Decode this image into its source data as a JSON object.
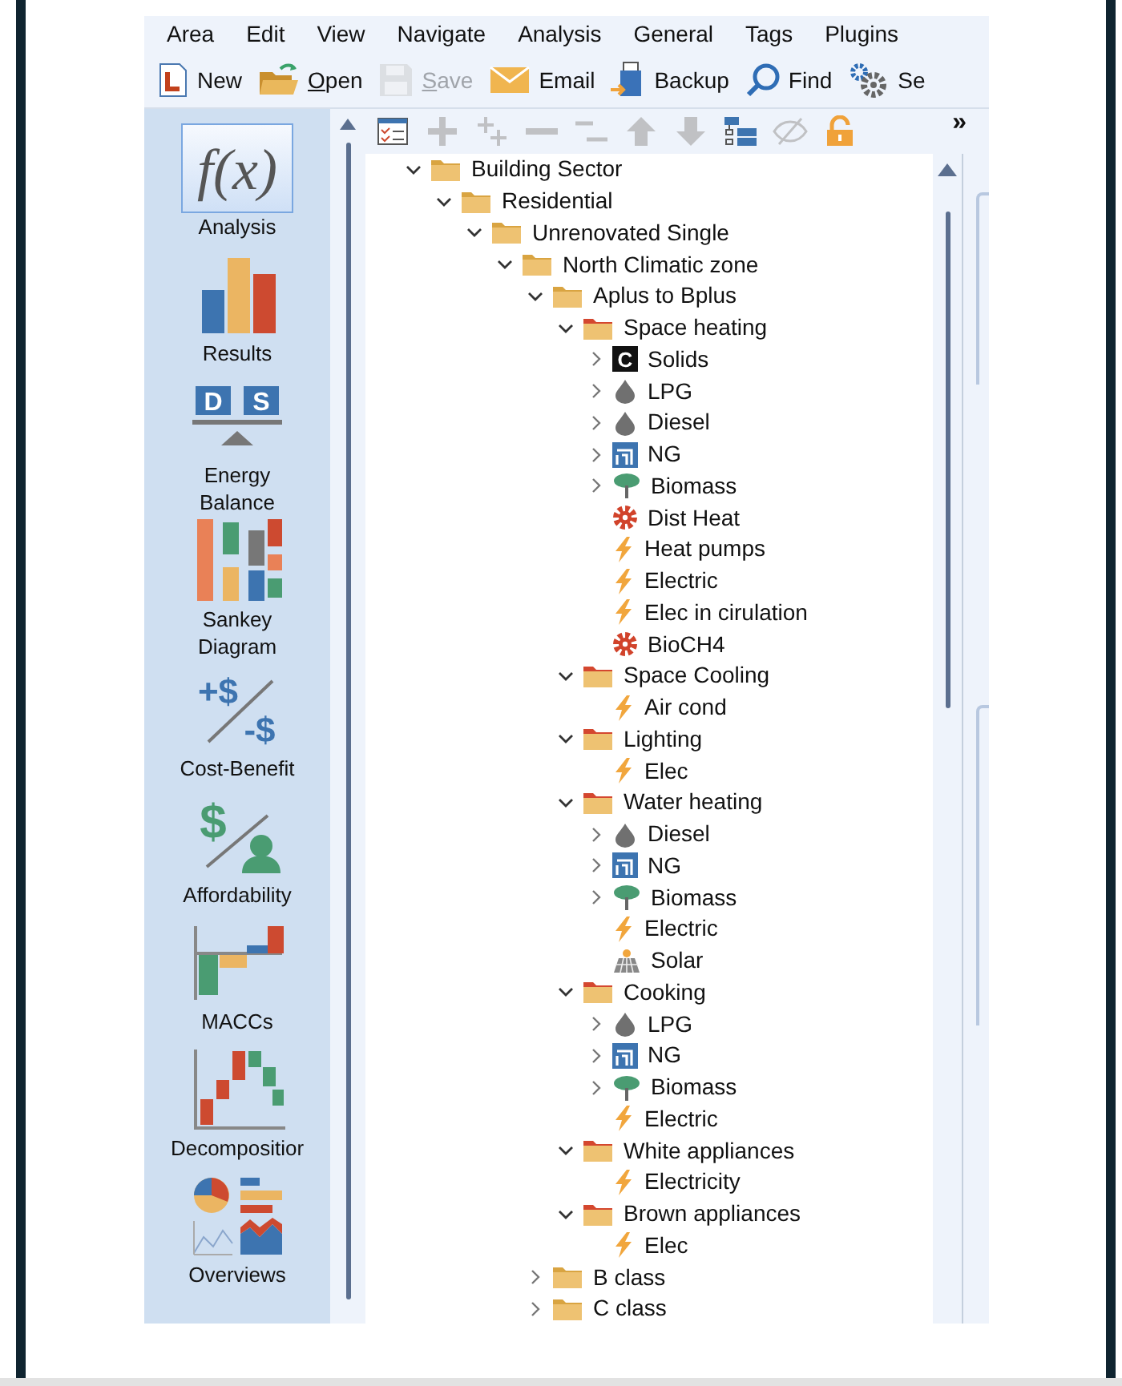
{
  "menu_bar": [
    "Area",
    "Edit",
    "View",
    "Navigate",
    "Analysis",
    "General",
    "Tags",
    "Plugins"
  ],
  "toolbar": [
    {
      "label": "New",
      "kind": "new",
      "disabled": false,
      "mnemonic": false
    },
    {
      "label": "Open",
      "kind": "open",
      "disabled": false,
      "mnemonic": true
    },
    {
      "label": "Save",
      "kind": "save",
      "disabled": true,
      "mnemonic": true
    },
    {
      "label": "Email",
      "kind": "email",
      "disabled": false,
      "mnemonic": false
    },
    {
      "label": "Backup",
      "kind": "backup",
      "disabled": false,
      "mnemonic": false
    },
    {
      "label": "Find",
      "kind": "find",
      "disabled": false,
      "mnemonic": false
    },
    {
      "label": "Se",
      "kind": "settings",
      "disabled": false,
      "mnemonic": false
    }
  ],
  "sidebar": [
    {
      "label": "Analysis",
      "kind": "fx",
      "icon_text": [
        "f(x)"
      ],
      "selected": true
    },
    {
      "label": "Results",
      "kind": "results",
      "selected": false
    },
    {
      "label": "Energy Balance",
      "kind": "balance",
      "icon_text": [
        "D",
        "S"
      ],
      "selected": false
    },
    {
      "label": "Sankey Diagram",
      "kind": "sankey",
      "selected": false
    },
    {
      "label": "Cost-Benefit",
      "kind": "costbenefit",
      "icon_text": [
        "+$",
        "-$"
      ],
      "selected": false
    },
    {
      "label": "Affordability",
      "kind": "afford",
      "icon_text": [
        "$"
      ],
      "selected": false
    },
    {
      "label": "MACCs",
      "kind": "maccs",
      "selected": false
    },
    {
      "label": "Decompositior",
      "kind": "decomp",
      "selected": false
    },
    {
      "label": "Overviews",
      "kind": "overviews",
      "selected": false
    }
  ],
  "tree_toolbar": {
    "tools": [
      {
        "kind": "checklist",
        "disabled": false
      },
      {
        "kind": "plus",
        "disabled": true
      },
      {
        "kind": "plusplus",
        "disabled": true
      },
      {
        "kind": "minus",
        "disabled": true
      },
      {
        "kind": "minusminus",
        "disabled": true
      },
      {
        "kind": "up",
        "disabled": true
      },
      {
        "kind": "down",
        "disabled": true
      },
      {
        "kind": "structure",
        "disabled": false
      },
      {
        "kind": "eye",
        "disabled": true
      },
      {
        "kind": "lock",
        "disabled": false
      }
    ],
    "overflow": "»"
  },
  "tree": [
    {
      "label": "Building Sector",
      "kind": "folder",
      "expanded": true,
      "children": [
        {
          "label": "Residential",
          "kind": "folder",
          "expanded": true,
          "children": [
            {
              "label": "Unrenovated Single",
              "kind": "folder",
              "expanded": true,
              "children": [
                {
                  "label": "North Climatic zone",
                  "kind": "folder",
                  "expanded": true,
                  "children": [
                    {
                      "label": "Aplus to Bplus",
                      "kind": "folder",
                      "expanded": true,
                      "children": [
                        {
                          "label": "Space heating",
                          "kind": "category",
                          "expanded": true,
                          "children": [
                            {
                              "label": "Solids",
                              "kind": "coal",
                              "icon_text": "C",
                              "expanded": false
                            },
                            {
                              "label": "LPG",
                              "kind": "drop",
                              "expanded": false
                            },
                            {
                              "label": "Diesel",
                              "kind": "drop",
                              "expanded": false
                            },
                            {
                              "label": "NG",
                              "kind": "gas",
                              "expanded": false
                            },
                            {
                              "label": "Biomass",
                              "kind": "tree",
                              "expanded": false
                            },
                            {
                              "label": "Dist Heat",
                              "kind": "gear"
                            },
                            {
                              "label": "Heat pumps",
                              "kind": "bolt"
                            },
                            {
                              "label": "Electric",
                              "kind": "bolt"
                            },
                            {
                              "label": "Elec in cirulation",
                              "kind": "bolt"
                            },
                            {
                              "label": "BioCH4",
                              "kind": "gear"
                            }
                          ]
                        },
                        {
                          "label": "Space Cooling",
                          "kind": "category",
                          "expanded": true,
                          "children": [
                            {
                              "label": "Air cond",
                              "kind": "bolt"
                            }
                          ]
                        },
                        {
                          "label": "Lighting",
                          "kind": "category",
                          "expanded": true,
                          "children": [
                            {
                              "label": "Elec",
                              "kind": "bolt"
                            }
                          ]
                        },
                        {
                          "label": "Water heating",
                          "kind": "category",
                          "expanded": true,
                          "children": [
                            {
                              "label": "Diesel",
                              "kind": "drop",
                              "expanded": false
                            },
                            {
                              "label": "NG",
                              "kind": "gas",
                              "expanded": false
                            },
                            {
                              "label": "Biomass",
                              "kind": "tree",
                              "expanded": false
                            },
                            {
                              "label": "Electric",
                              "kind": "bolt"
                            },
                            {
                              "label": "Solar",
                              "kind": "solar"
                            }
                          ]
                        },
                        {
                          "label": "Cooking",
                          "kind": "category",
                          "expanded": true,
                          "children": [
                            {
                              "label": "LPG",
                              "kind": "drop",
                              "expanded": false
                            },
                            {
                              "label": "NG",
                              "kind": "gas",
                              "expanded": false
                            },
                            {
                              "label": "Biomass",
                              "kind": "tree",
                              "expanded": false
                            },
                            {
                              "label": "Electric",
                              "kind": "bolt"
                            }
                          ]
                        },
                        {
                          "label": "White appliances",
                          "kind": "category",
                          "expanded": true,
                          "children": [
                            {
                              "label": "Electricity",
                              "kind": "bolt"
                            }
                          ]
                        },
                        {
                          "label": "Brown appliances",
                          "kind": "category",
                          "expanded": true,
                          "children": [
                            {
                              "label": "Elec",
                              "kind": "bolt"
                            }
                          ]
                        }
                      ]
                    },
                    {
                      "label": "B class",
                      "kind": "folder",
                      "expanded": false
                    },
                    {
                      "label": "C class",
                      "kind": "folder",
                      "expanded": false
                    }
                  ]
                }
              ]
            }
          ]
        }
      ]
    }
  ]
}
